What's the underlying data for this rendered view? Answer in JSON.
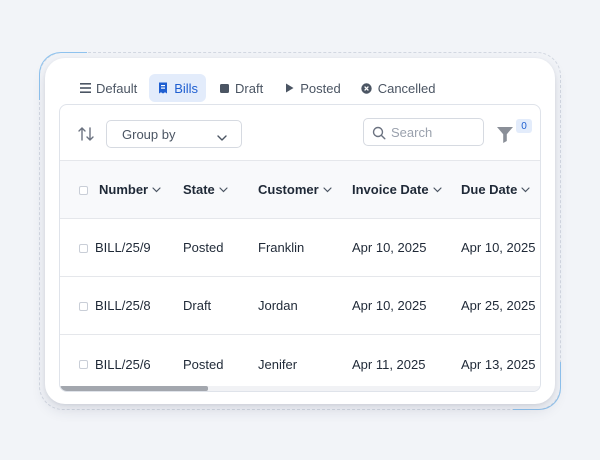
{
  "tabs": [
    {
      "label": "Default",
      "icon": "list-icon",
      "active": false
    },
    {
      "label": "Bills",
      "icon": "bill-icon",
      "active": true
    },
    {
      "label": "Draft",
      "icon": "square-icon",
      "active": false
    },
    {
      "label": "Posted",
      "icon": "play-icon",
      "active": false
    },
    {
      "label": "Cancelled",
      "icon": "cancel-circle-icon",
      "active": false
    }
  ],
  "toolbar": {
    "group_by_label": "Group by",
    "search_placeholder": "Search",
    "filter_count": "0"
  },
  "table": {
    "columns": [
      "Number",
      "State",
      "Customer",
      "Invoice Date",
      "Due Date"
    ],
    "rows": [
      {
        "number": "BILL/25/9",
        "state": "Posted",
        "customer": "Franklin",
        "invoice_date": "Apr 10, 2025",
        "due_date": "Apr 10, 2025"
      },
      {
        "number": "BILL/25/8",
        "state": "Draft",
        "customer": "Jordan",
        "invoice_date": "Apr 10, 2025",
        "due_date": "Apr 25, 2025"
      },
      {
        "number": "BILL/25/6",
        "state": "Posted",
        "customer": "Jenifer",
        "invoice_date": "Apr 11, 2025",
        "due_date": "Apr 13, 2025"
      }
    ]
  },
  "colors": {
    "accent": "#1f5fd1",
    "accent_bg": "#e3ecfb",
    "border": "#dfe3ea",
    "page_bg": "#f2f4f8"
  }
}
